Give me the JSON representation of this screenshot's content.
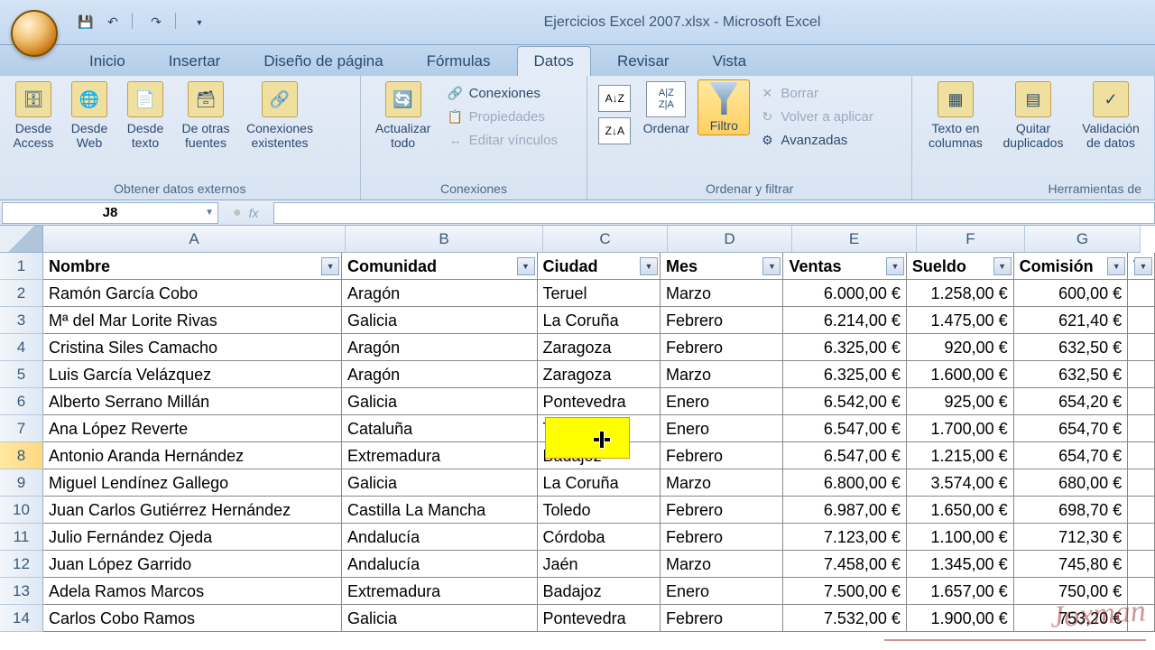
{
  "title": "Ejercicios Excel 2007.xlsx - Microsoft Excel",
  "name_box": "J8",
  "tabs": {
    "inicio": "Inicio",
    "insertar": "Insertar",
    "diseno": "Diseño de página",
    "formulas": "Fórmulas",
    "datos": "Datos",
    "revisar": "Revisar",
    "vista": "Vista"
  },
  "ribbon": {
    "group_externos": "Obtener datos externos",
    "desde_access": "Desde Access",
    "desde_web": "Desde Web",
    "desde_texto": "Desde texto",
    "de_otras": "De otras fuentes",
    "conexiones_exist": "Conexiones existentes",
    "group_conexiones": "Conexiones",
    "actualizar": "Actualizar todo",
    "conexiones": "Conexiones",
    "propiedades": "Propiedades",
    "editar_vinculos": "Editar vínculos",
    "group_ordenar": "Ordenar y filtrar",
    "ordenar": "Ordenar",
    "filtro": "Filtro",
    "borrar": "Borrar",
    "volver": "Volver a aplicar",
    "avanzadas": "Avanzadas",
    "group_herramientas": "Herramientas de",
    "texto_col": "Texto en columnas",
    "quitar_dup": "Quitar duplicados",
    "validacion": "Validación de datos"
  },
  "columns": [
    "A",
    "B",
    "C",
    "D",
    "E",
    "F",
    "G"
  ],
  "headers": {
    "A": "Nombre",
    "B": "Comunidad",
    "C": "Ciudad",
    "D": "Mes",
    "E": "Ventas",
    "F": "Sueldo",
    "G": "Comisión",
    "H": "T"
  },
  "rows": [
    {
      "n": 1
    },
    {
      "n": 2,
      "A": "Ramón García Cobo",
      "B": "Aragón",
      "C": "Teruel",
      "D": "Marzo",
      "E": "6.000,00 €",
      "F": "1.258,00 €",
      "G": "600,00 €"
    },
    {
      "n": 3,
      "A": "Mª del Mar Lorite Rivas",
      "B": "Galicia",
      "C": "La Coruña",
      "D": "Febrero",
      "E": "6.214,00 €",
      "F": "1.475,00 €",
      "G": "621,40 €"
    },
    {
      "n": 4,
      "A": "Cristina Siles Camacho",
      "B": "Aragón",
      "C": "Zaragoza",
      "D": "Febrero",
      "E": "6.325,00 €",
      "F": "920,00 €",
      "G": "632,50 €"
    },
    {
      "n": 5,
      "A": "Luis García Velázquez",
      "B": "Aragón",
      "C": "Zaragoza",
      "D": "Marzo",
      "E": "6.325,00 €",
      "F": "1.600,00 €",
      "G": "632,50 €"
    },
    {
      "n": 6,
      "A": "Alberto Serrano Millán",
      "B": "Galicia",
      "C": "Pontevedra",
      "D": "Enero",
      "E": "6.542,00 €",
      "F": "925,00 €",
      "G": "654,20 €"
    },
    {
      "n": 7,
      "A": "Ana López Reverte",
      "B": "Cataluña",
      "C": "Tarragona",
      "D": "Enero",
      "E": "6.547,00 €",
      "F": "1.700,00 €",
      "G": "654,70 €"
    },
    {
      "n": 8,
      "A": "Antonio Aranda Hernández",
      "B": "Extremadura",
      "C": "Badajoz",
      "D": "Febrero",
      "E": "6.547,00 €",
      "F": "1.215,00 €",
      "G": "654,70 €"
    },
    {
      "n": 9,
      "A": "Miguel Lendínez Gallego",
      "B": "Galicia",
      "C": "La Coruña",
      "D": "Marzo",
      "E": "6.800,00 €",
      "F": "3.574,00 €",
      "G": "680,00 €"
    },
    {
      "n": 10,
      "A": "Juan Carlos Gutiérrez Hernández",
      "B": "Castilla La Mancha",
      "C": "Toledo",
      "D": "Febrero",
      "E": "6.987,00 €",
      "F": "1.650,00 €",
      "G": "698,70 €"
    },
    {
      "n": 11,
      "A": "Julio Fernández Ojeda",
      "B": "Andalucía",
      "C": "Córdoba",
      "D": "Febrero",
      "E": "7.123,00 €",
      "F": "1.100,00 €",
      "G": "712,30 €"
    },
    {
      "n": 12,
      "A": "Juan López Garrido",
      "B": "Andalucía",
      "C": "Jaén",
      "D": "Marzo",
      "E": "7.458,00 €",
      "F": "1.345,00 €",
      "G": "745,80 €"
    },
    {
      "n": 13,
      "A": "Adela Ramos Marcos",
      "B": "Extremadura",
      "C": "Badajoz",
      "D": "Enero",
      "E": "7.500,00 €",
      "F": "1.657,00 €",
      "G": "750,00 €"
    },
    {
      "n": 14,
      "A": "Carlos Cobo Ramos",
      "B": "Galicia",
      "C": "Pontevedra",
      "D": "Febrero",
      "E": "7.532,00 €",
      "F": "1.900,00 €",
      "G": "753,20 €"
    }
  ],
  "watermark": "Joxman"
}
